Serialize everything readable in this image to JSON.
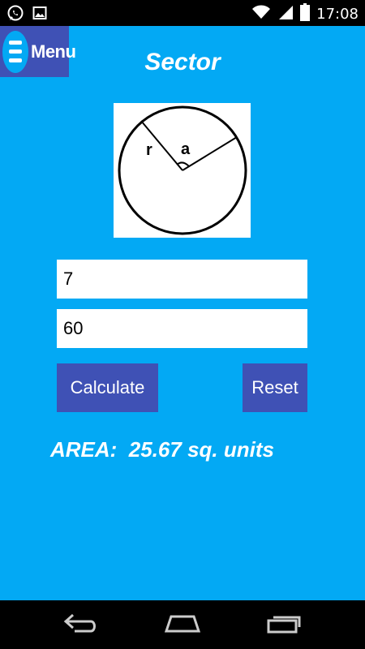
{
  "status_bar": {
    "time": "17:08",
    "icons": [
      "whatsapp-icon",
      "image-icon",
      "wifi-icon",
      "signal-icon",
      "battery-icon"
    ]
  },
  "toolbar": {
    "menu_label": "Menu"
  },
  "page": {
    "title": "Sector"
  },
  "diagram": {
    "radius_label": "r",
    "angle_label": "a"
  },
  "inputs": {
    "radius_value": "7",
    "angle_value": "60"
  },
  "buttons": {
    "calculate_label": "Calculate",
    "reset_label": "Reset"
  },
  "result": {
    "text": "AREA:  25.67 sq. units"
  },
  "nav_bar": {
    "icons": [
      "back-icon",
      "home-icon",
      "recent-apps-icon"
    ]
  },
  "colors": {
    "background": "#03A9F4",
    "button": "#3F51B5",
    "text": "#FFFFFF"
  }
}
